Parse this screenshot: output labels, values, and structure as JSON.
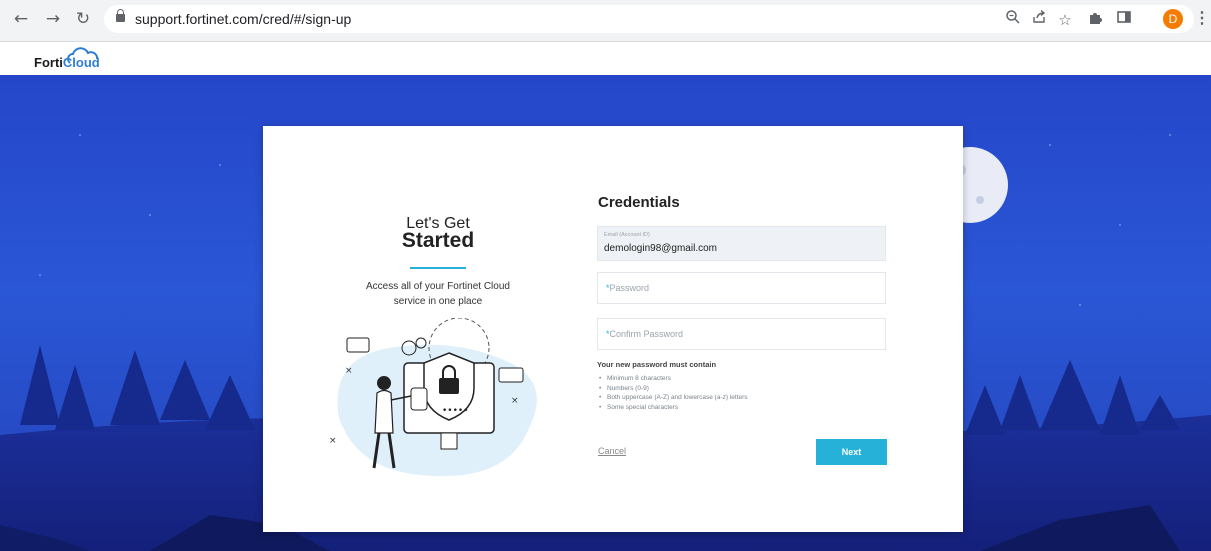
{
  "browser": {
    "back_icon": "arrow-left-icon",
    "forward_icon": "arrow-right-icon",
    "reload_icon": "reload-icon",
    "url": "support.fortinet.com/cred/#/sign-up",
    "profile_initial": "D"
  },
  "header": {
    "logo_prefix": "Forti",
    "logo_suffix": "Cloud"
  },
  "intro": {
    "line1": "Let's Get",
    "line2": "Started",
    "tagline": "Access all of your Fortinet Cloud service in one place"
  },
  "form": {
    "title": "Credentials",
    "email_label": "Email (Account ID)",
    "email_value": "demologin98@gmail.com",
    "password_placeholder": "Password",
    "confirm_placeholder": "Confirm Password",
    "required_marker": "*",
    "rules_title": "Your new password must contain",
    "rules": [
      "Minimum 8 characters",
      "Numbers (0-9)",
      "Both uppercase (A-Z) and lowercase (a-z) letters",
      "Some special characters"
    ],
    "cancel_label": "Cancel",
    "next_label": "Next"
  },
  "colors": {
    "accent": "#26b2d8",
    "background_blue": "#2a57d6",
    "avatar": "#f57c00"
  }
}
